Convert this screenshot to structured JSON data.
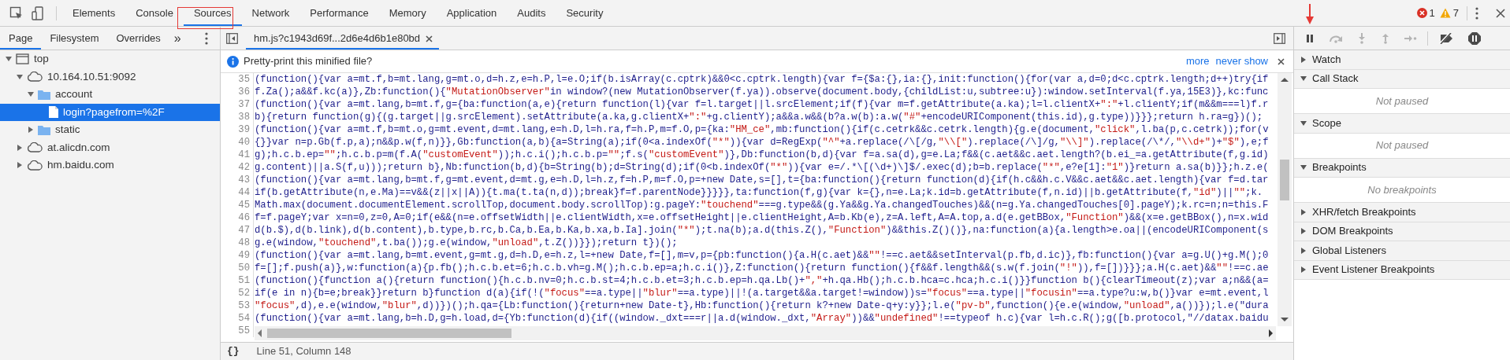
{
  "toolbar": {
    "tabs": [
      {
        "label": "Elements",
        "selected": false
      },
      {
        "label": "Console",
        "selected": false
      },
      {
        "label": "Sources",
        "selected": true
      },
      {
        "label": "Network",
        "selected": false
      },
      {
        "label": "Performance",
        "selected": false
      },
      {
        "label": "Memory",
        "selected": false
      },
      {
        "label": "Application",
        "selected": false
      },
      {
        "label": "Audits",
        "selected": false
      },
      {
        "label": "Security",
        "selected": false
      }
    ],
    "errors": "1",
    "warnings": "7"
  },
  "navigator": {
    "tabs": [
      {
        "label": "Page",
        "selected": true
      },
      {
        "label": "Filesystem",
        "selected": false
      },
      {
        "label": "Overrides",
        "selected": false
      }
    ],
    "more": "»",
    "tree": [
      {
        "kind": "frame",
        "label": "top",
        "expanded": true,
        "selected": false,
        "children": [
          {
            "kind": "domain",
            "label": "10.164.10.51:9092",
            "expanded": true,
            "selected": false,
            "children": [
              {
                "kind": "folder",
                "label": "account",
                "expanded": true,
                "selected": false,
                "children": [
                  {
                    "kind": "file",
                    "label": "login?pagefrom=%2F",
                    "selected": true
                  }
                ]
              },
              {
                "kind": "folder",
                "label": "static",
                "expanded": false,
                "selected": false
              }
            ]
          },
          {
            "kind": "domain",
            "label": "at.alicdn.com",
            "expanded": false,
            "selected": false
          },
          {
            "kind": "domain",
            "label": "hm.baidu.com",
            "expanded": false,
            "selected": false
          }
        ]
      }
    ]
  },
  "editor": {
    "file_tab": {
      "label": "hm.js?c1943d69f...2d6e4d6b1e80bd",
      "selected": true
    },
    "infobar": {
      "message": "Pretty-print this minified file?",
      "links": [
        "more",
        "never show"
      ]
    },
    "lines": [
      {
        "number": "35",
        "code": "(function(){var a=mt.f,b=mt.lang,g=mt.o,d=h.z,e=h.P,l=e.O;if(b.isArray(c.cptrk)&&0<c.cptrk.length){var f={$a:{},ia:{},init:function(){for(var a,d=0;d<c.cptrk.length;d++)try{if"
      },
      {
        "number": "36",
        "code": "f.Za();a&&f.kc(a)},Zb:function(){\"MutationObserver\"in window?(new MutationObserver(f.ya)).observe(document.body,{childList:u,subtree:u}):window.setInterval(f.ya,15E3)},kc:func"
      },
      {
        "number": "37",
        "code": "(function(){var a=mt.lang,b=mt.f,g={ba:function(a,e){return function(l){var f=l.target||l.srcElement;if(f){var m=f.getAttribute(a.ka);l=l.clientX+\":\"+l.clientY;if(m&&m===l)f.r"
      },
      {
        "number": "38",
        "code": "b){return function(g){(g.target||g.srcElement).setAttribute(a.ka,g.clientX+\":\"+g.clientY);a&&a.w&&(b?a.w(b):a.w(\"#\"+encodeURIComponent(this.id),g.type))}}};return h.ra=g})();"
      },
      {
        "number": "39",
        "code": "(function(){var a=mt.f,b=mt.o,g=mt.event,d=mt.lang,e=h.D,l=h.ra,f=h.P,m=f.O,p={ka:\"HM_ce\",mb:function(){if(c.cetrk&&c.cetrk.length){g.e(document,\"click\",l.ba(p,c.cetrk));for(v"
      },
      {
        "number": "40",
        "code": "{}}var n=p.Gb(f.p,a);n&&p.w(f,n)}},Gb:function(a,b){a=String(a);if(0<a.indexOf(\"*\")){var d=RegExp(\"^\"+a.replace(/\\[/g,\"\\\\[\").replace(/\\]/g,\"\\\\]\").replace(/\\*/,\"\\\\d+\")+\"$\"),e;f"
      },
      {
        "number": "41",
        "code": "g);h.c.b.ep=\"\";h.c.b.p=m(f.A(\"customEvent\"));h.c.i();h.c.b.p=\"\";f.s(\"customEvent\")},Db:function(b,d){var f=a.sa(d),g=e.La;f&&(c.aet&&c.aet.length?(b.ei_=a.getAttribute(f,g.id)"
      },
      {
        "number": "42",
        "code": "g.content)||a.S(f,u)));return b},Nb:function(b,d){b=String(b);d=String(d);if(0<b.indexOf(\"*\")){var e=/.*\\[(\\d+)\\]$/.exec(d);b=b.replace(\"*\",e?e[1]:\"1\")}return a.sa(b)}};h.z.e("
      },
      {
        "number": "43",
        "code": "(function(){var a=mt.lang,b=mt.f,g=mt.event,d=mt.g,e=h.D,l=h.z,f=h.P,m=f.O,p=+new Date,s=[],t={ba:function(){return function(d){if(h.c&&h.c.V&&c.aet&&c.aet.length){var f=d.tar"
      },
      {
        "number": "44",
        "code": "if(b.getAttribute(n,e.Ma)==v&&(z||x||A)){t.ma(t.ta(n,d));break}f=f.parentNode}}}}},ta:function(f,g){var k={},n=e.La;k.id=b.getAttribute(f,n.id)||b.getAttribute(f,\"id\")||\"\";k."
      },
      {
        "number": "45",
        "code": "Math.max(document.documentElement.scrollTop,document.body.scrollTop):g.pageY:\"touchend\"===g.type&&(g.Ya&&g.Ya.changedTouches)&&(n=g.Ya.changedTouches[0].pageY);k.rc=n;n=this.F"
      },
      {
        "number": "46",
        "code": "f=f.pageY;var x=n=0,z=0,A=0;if(e&&(n=e.offsetWidth||e.clientWidth,x=e.offsetHeight||e.clientHeight,A=b.Kb(e),z=A.left,A=A.top,a.d(e.getBBox,\"Function\")&&(x=e.getBBox(),n=x.wid"
      },
      {
        "number": "47",
        "code": "d(b.$),d(b.link),d(b.content),b.type,b.rc,b.Ca,b.Ea,b.Ka,b.xa,b.Ia].join(\"*\");t.na(b);a.d(this.Z(),\"Function\")&&this.Z()()},na:function(a){a.length>e.oa||(encodeURIComponent(s"
      },
      {
        "number": "48",
        "code": "g.e(window,\"touchend\",t.ba());g.e(window,\"unload\",t.Z())}});return t})();"
      },
      {
        "number": "49",
        "code": "(function(){var a=mt.lang,b=mt.event,g=mt.g,d=h.D,e=h.z,l=+new Date,f=[],m=v,p={pb:function(){a.H(c.aet)&&\"\"!==c.aet&&setInterval(p.fb,d.ic)},fb:function(){var a=g.U()+g.M();0"
      },
      {
        "number": "50",
        "code": "f=[];f.push(a)},w:function(a){p.fb();h.c.b.et=6;h.c.b.vh=g.M();h.c.b.ep=a;h.c.i()},Z:function(){return function(){f&&f.length&&(s.w(f.join(\"!\")),f=[])}}};a.H(c.aet)&&\"\"!==c.ae"
      },
      {
        "number": "51",
        "code": "(function(){function a(){return function(){h.c.b.nv=0;h.c.b.st=4;h.c.b.et=3;h.c.b.ep=h.qa.Lb()+\",\"+h.qa.Hb();h.c.b.hca=c.hca;h.c.i()}}function b(){clearTimeout(z);var a;n&&(a="
      },
      {
        "number": "52",
        "code": "if(e in n){b=e;break}}return b}function d(a){if(!(\"focus\"==a.type||\"blur\"==a.type)||!(a.target&&a.target!=window))s=\"focus\"==a.type||\"focusin\"==a.type?u:w,b()}var e=mt.event,l"
      },
      {
        "number": "53",
        "code": "\"focus\",d),e.e(window,\"blur\",d))})();h.qa={Lb:function(){return+new Date-t},Hb:function(){return k?+new Date-q+y:y}};l.e(\"pv-b\",function(){e.e(window,\"unload\",a())});l.e(\"dura"
      },
      {
        "number": "54",
        "code": "(function(){var a=mt.lang,b=h.D,g=h.load,d={Yb:function(d){if((window._dxt===r||a.d(window._dxt,\"Array\"))&&\"undefined\"!==typeof h.c){var l=h.c.R();g([b.protocol,\"//datax.baidu"
      },
      {
        "number": "55"
      }
    ],
    "status": {
      "format_button": "{}",
      "position": "Line 51, Column 148"
    }
  },
  "debugger": {
    "controls": [
      {
        "kind": "pause",
        "disabled": false
      },
      {
        "kind": "step-over",
        "disabled": true
      },
      {
        "kind": "step-into",
        "disabled": true
      },
      {
        "kind": "step-out",
        "disabled": true
      },
      {
        "kind": "step",
        "disabled": true
      },
      {
        "kind": "deactivate",
        "disabled": false
      },
      {
        "kind": "pause-exceptions",
        "disabled": false
      }
    ],
    "sections": [
      {
        "title": "Watch",
        "expanded": false
      },
      {
        "title": "Call Stack",
        "expanded": true,
        "body": "Not paused"
      },
      {
        "title": "Scope",
        "expanded": true,
        "body": "Not paused"
      },
      {
        "title": "Breakpoints",
        "expanded": true,
        "body": "No breakpoints"
      },
      {
        "title": "XHR/fetch Breakpoints",
        "expanded": false
      },
      {
        "title": "DOM Breakpoints",
        "expanded": false
      },
      {
        "title": "Global Listeners",
        "expanded": false
      },
      {
        "title": "Event Listener Breakpoints",
        "expanded": false
      }
    ]
  }
}
